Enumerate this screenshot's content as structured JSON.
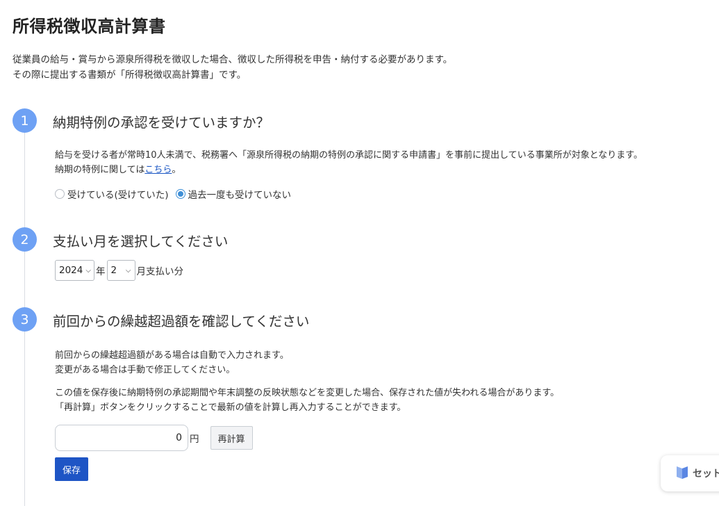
{
  "page": {
    "title": "所得税徴収高計算書",
    "intro": [
      "従業員の給与・賞与から源泉所得税を徴収した場合、徴収した所得税を申告・納付する必要があります。",
      "その際に提出する書類が「所得税徴収高計算書」です。"
    ]
  },
  "steps": [
    {
      "number": "1",
      "title": "納期特例の承認を受けていますか？",
      "desc_line1": "給与を受ける者が常時10人未満で、税務署へ「源泉所得税の納期の特例の承認に関する申請書」を事前に提出している事業所が対象となります。",
      "desc_line2_prefix": "納期の特例に関しては",
      "desc_link": "こちら",
      "desc_line2_suffix": "。",
      "radio_options": [
        {
          "label": "受けている(受けていた)",
          "selected": false
        },
        {
          "label": "過去一度も受けていない",
          "selected": true
        }
      ]
    },
    {
      "number": "2",
      "title": "支払い月を選択してください",
      "year_value": "2024",
      "year_unit": "年",
      "month_value": "2",
      "month_unit": "月支払い分"
    },
    {
      "number": "3",
      "title": "前回からの繰越超過額を確認してください",
      "desc": [
        "前回からの繰越超過額がある場合は自動で入力されます。",
        "変更がある場合は手動で修正してください。"
      ],
      "note": [
        "この値を保存後に納期特例の承認期間や年末調整の反映状態などを変更した場合、保存された値が失われる場合があります。",
        "「再計算」ボタンをクリックすることで最新の値を計算し再入力することができます。"
      ],
      "amount_value": "0",
      "amount_unit": "円",
      "recalc_label": "再計算",
      "save_label": "保存"
    }
  ],
  "widget": {
    "label": "セット",
    "icon": "book-icon"
  },
  "colors": {
    "accent": "#6ea1f4",
    "primary": "#1e55c5",
    "link": "#1a56c4",
    "radio": "#3f8fd6"
  }
}
